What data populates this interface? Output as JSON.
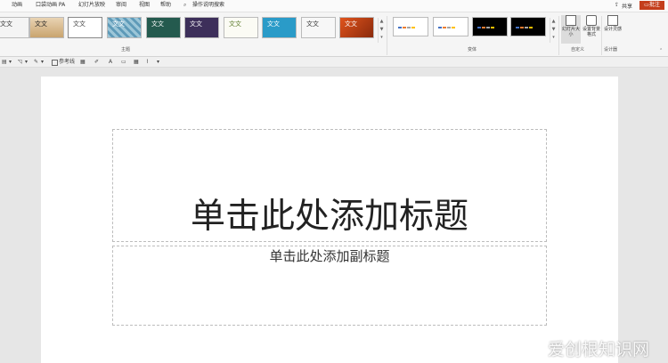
{
  "menu": {
    "items": [
      "动画",
      "口袋动画 PA",
      "幻灯片放映",
      "审阅",
      "视图",
      "帮助",
      "操作说明搜索"
    ],
    "share": "共享",
    "comment": "批注"
  },
  "ribbon": {
    "themes_label": "主题",
    "theme_sample_text": "文文",
    "variants_label": "变体",
    "customize_label": "自定义",
    "designer_label": "设计器",
    "slide_size": "幻灯片大小",
    "format_background": "设置背景格式",
    "design_ideas": "设计灵感"
  },
  "qat": {
    "reference_line": "参考线"
  },
  "slide": {
    "title_placeholder": "单击此处添加标题",
    "subtitle_placeholder": "单击此处添加副标题"
  },
  "watermark": "爱创根知识网"
}
